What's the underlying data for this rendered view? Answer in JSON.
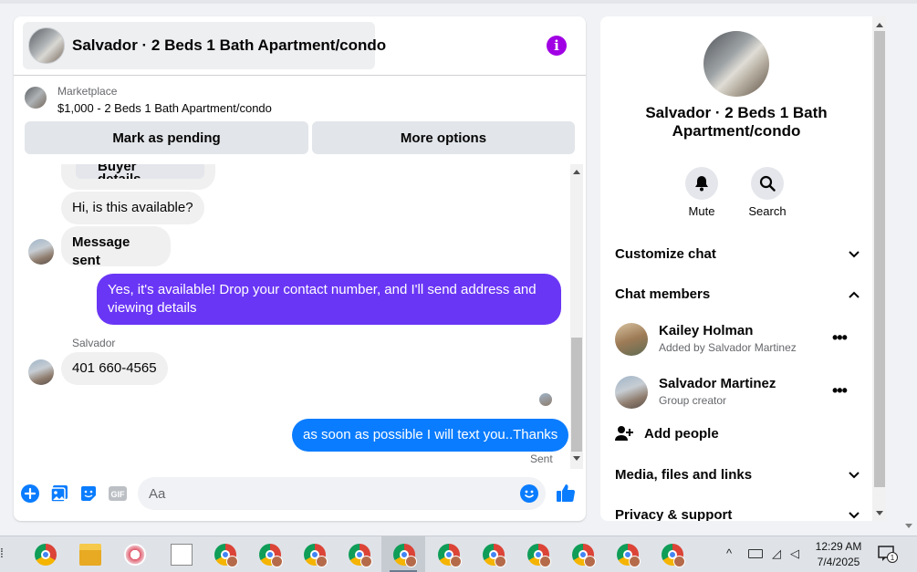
{
  "chat": {
    "title": "Salvador · 2 Beds 1 Bath Apartment/condo",
    "marketplace_label": "Marketplace",
    "listing": "$1,000 - 2 Beds 1 Bath Apartment/condo",
    "mark_pending": "Mark as pending",
    "more_options": "More options",
    "messages": {
      "partial": "Buyer details",
      "m1": "Hi, is this available?",
      "m2": "Message sent",
      "m3": "Yes, it's available! Drop your contact number, and I'll send address and viewing details",
      "sender": "Salvador",
      "m4": "401 660-4565",
      "m5": "as soon as possible I will text you..Thanks",
      "status": "Sent"
    },
    "composer_placeholder": "Aa",
    "composer_icons": [
      "plus-icon",
      "photo-icon",
      "sticker-icon",
      "gif-icon",
      "emoji-icon",
      "thumbs-up-icon"
    ],
    "gif_label": "GIF"
  },
  "info": {
    "title": "Salvador · 2 Beds 1 Bath Apartment/condo",
    "mute": "Mute",
    "search": "Search",
    "customize": "Customize chat",
    "members_header": "Chat members",
    "members": [
      {
        "name": "Kailey Holman",
        "sub": "Added by Salvador Martinez"
      },
      {
        "name": "Salvador Martinez",
        "sub": "Group creator"
      }
    ],
    "add_people": "Add people",
    "media": "Media, files and links",
    "privacy": "Privacy & support"
  },
  "taskbar": {
    "time": "12:29 AM",
    "date": "7/4/2025",
    "notification_count": "1"
  },
  "colors": {
    "purple_bubble": "#6a36f5",
    "blue_bubble": "#0a7cff",
    "info_purple": "#a100e4"
  }
}
